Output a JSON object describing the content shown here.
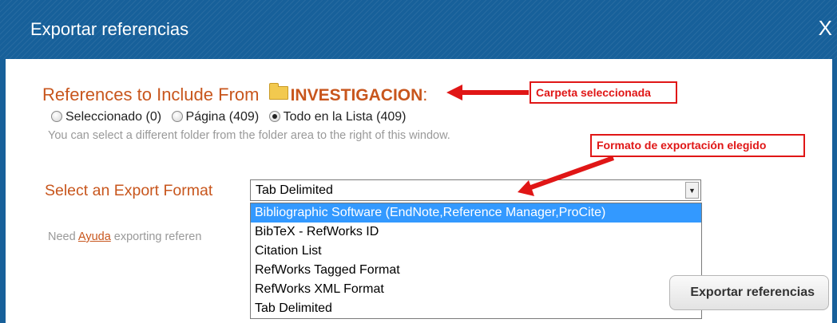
{
  "dialog": {
    "title": "Exportar referencias",
    "close_label": "X"
  },
  "references": {
    "heading_prefix": "References to Include From",
    "folder_name": "INVESTIGACION",
    "heading_suffix": ":",
    "options": [
      {
        "label": "Seleccionado (0)",
        "checked": false
      },
      {
        "label": "Página (409)",
        "checked": false
      },
      {
        "label": "Todo en la Lista (409)",
        "checked": true
      }
    ],
    "hint": "You can select a different folder from the folder area to the right of this window."
  },
  "export_format": {
    "label": "Select an Export Format",
    "selected_value": "Tab Delimited",
    "options": [
      {
        "label": "Bibliographic Software (EndNote,Reference Manager,ProCite)",
        "highlighted": true
      },
      {
        "label": "BibTeX - RefWorks ID",
        "highlighted": false
      },
      {
        "label": "Citation List",
        "highlighted": false
      },
      {
        "label": "RefWorks Tagged Format",
        "highlighted": false
      },
      {
        "label": "RefWorks XML Format",
        "highlighted": false
      },
      {
        "label": "Tab Delimited",
        "highlighted": false
      }
    ]
  },
  "help": {
    "prefix": "Need",
    "link": "Ayuda",
    "suffix": "exporting referen"
  },
  "export_button": {
    "label": "Exportar referencias"
  },
  "annotations": {
    "folder_callout": "Carpeta seleccionada",
    "format_callout": "Formato de exportación elegido",
    "color": "#e01616"
  },
  "colors": {
    "titlebar": "#17609a",
    "accent_orange": "#c8561d",
    "selection": "#3399ff"
  }
}
